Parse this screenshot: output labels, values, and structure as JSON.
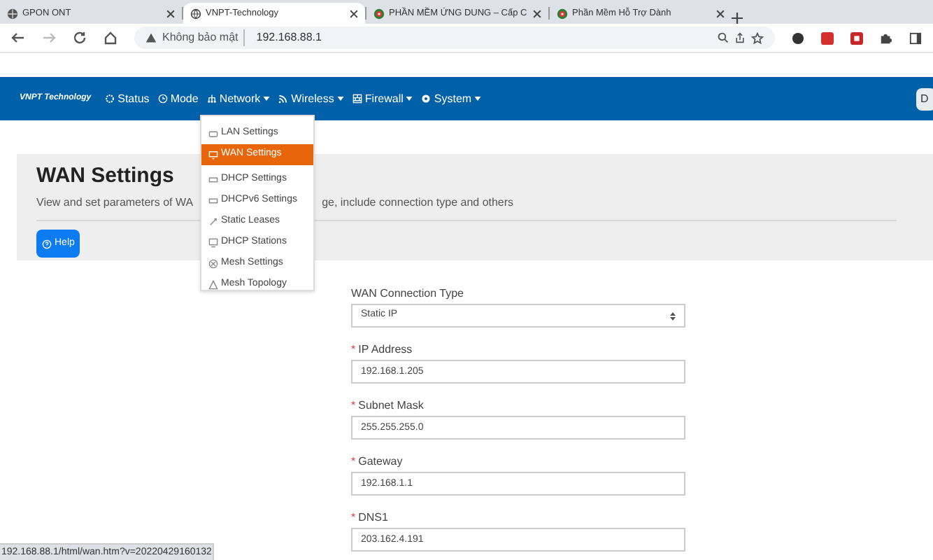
{
  "browser_tabs": [
    {
      "title": "GPON ONT",
      "selected": false,
      "kind": "globe-dark"
    },
    {
      "title": "VNPT-Technology",
      "selected": true,
      "kind": "globe"
    },
    {
      "title": "PHẦN MỀM ỨNG DUNG – Cấp C",
      "selected": false,
      "kind": "app"
    },
    {
      "title": "Phần Mềm Hỗ Trợ Dành",
      "selected": false,
      "kind": "app"
    }
  ],
  "address_bar": {
    "security": "Không bảo mật",
    "url": "192.168.88.1"
  },
  "navbar": {
    "logo": "VNPT Technology",
    "items": [
      {
        "label": "Status",
        "caret": false
      },
      {
        "label": "Mode",
        "caret": false
      },
      {
        "label": "Network",
        "caret": true
      },
      {
        "label": "Wireless",
        "caret": true
      },
      {
        "label": "Firewall",
        "caret": true
      },
      {
        "label": "System",
        "caret": true
      }
    ],
    "right_button": "D"
  },
  "network_menu": [
    {
      "label": "LAN Settings",
      "selected": false
    },
    {
      "label": "WAN Settings",
      "selected": true
    },
    {
      "label": "DHCP Settings",
      "selected": false
    },
    {
      "label": "DHCPv6 Settings",
      "selected": false
    },
    {
      "label": "Static Leases",
      "selected": false
    },
    {
      "label": "DHCP Stations",
      "selected": false
    },
    {
      "label": "Mesh Settings",
      "selected": false
    },
    {
      "label": "Mesh Topology",
      "selected": false
    }
  ],
  "header": {
    "title": "WAN Settings",
    "description_start": "View and set parameters of WA",
    "description_end": "ge, include connection type and others",
    "help_button": "Help"
  },
  "form": [
    {
      "kind": "select",
      "label": "WAN Connection Type",
      "value": "Static IP"
    },
    {
      "kind": "text",
      "required_mark": "*",
      "label": "IP Address",
      "value": "192.168.1.205"
    },
    {
      "kind": "text",
      "required_mark": "*",
      "label": "Subnet Mask",
      "value": "255.255.255.0"
    },
    {
      "kind": "text",
      "required_mark": "*",
      "label": "Gateway",
      "value": "192.168.1.1"
    },
    {
      "kind": "text",
      "required_mark": "*",
      "label": "DNS1",
      "value": "203.162.4.191"
    }
  ],
  "status_url": "192.168.88.1/html/wan.htm?v=20220429160132"
}
